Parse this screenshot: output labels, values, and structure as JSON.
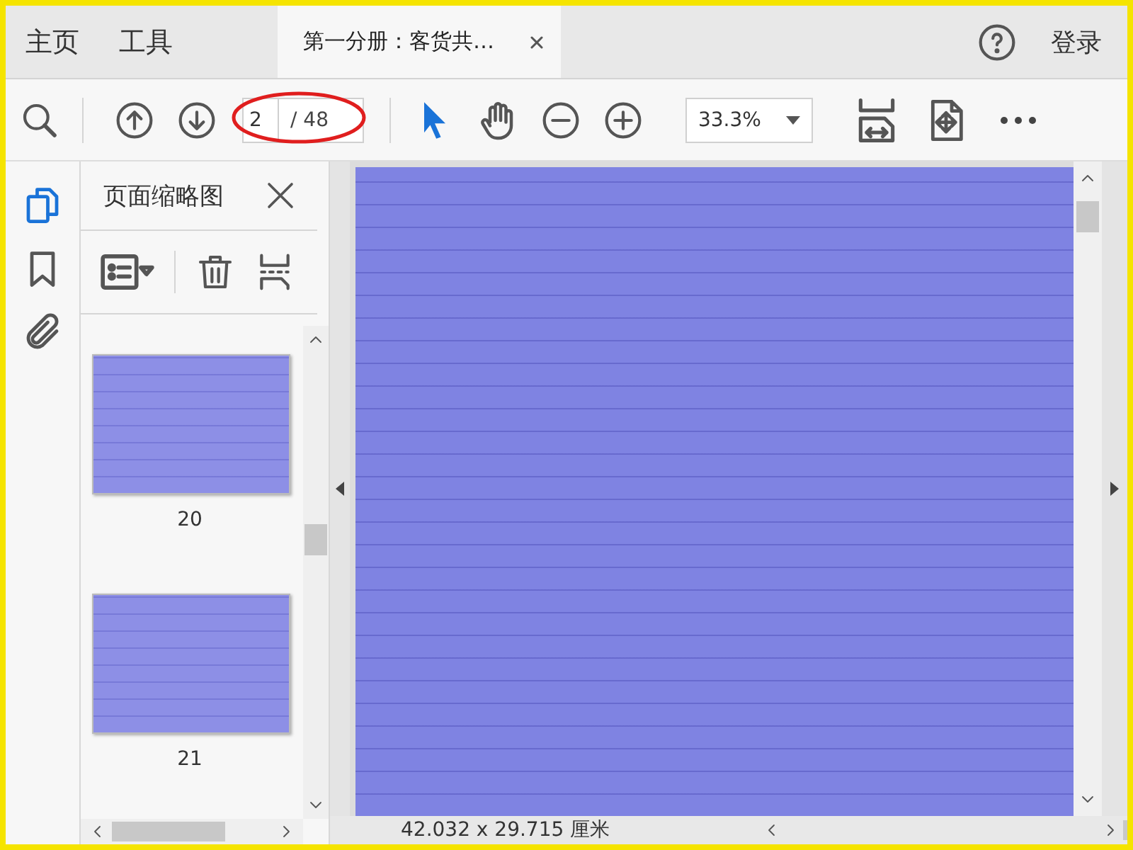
{
  "nav": [
    {
      "label": "主页",
      "selected": false
    },
    {
      "label": "工具",
      "selected": false
    }
  ],
  "tabs": [
    {
      "label": "第一分册：客货共…",
      "selected": true
    }
  ],
  "account": {
    "signin": "登录"
  },
  "toolbar": {
    "page": {
      "value": "2",
      "total": "/ 48"
    },
    "zoom": {
      "value": "33.3%"
    }
  },
  "rail": [
    {
      "kind": "pages",
      "selected": true
    },
    {
      "kind": "bookmarks",
      "selected": false
    },
    {
      "kind": "attachments",
      "selected": false
    }
  ],
  "panel": {
    "title": "页面缩略图",
    "thumbnails": [
      {
        "page": "20"
      },
      {
        "page": "21"
      }
    ]
  },
  "status": {
    "page_size": "42.032 x 29.715 厘米"
  }
}
